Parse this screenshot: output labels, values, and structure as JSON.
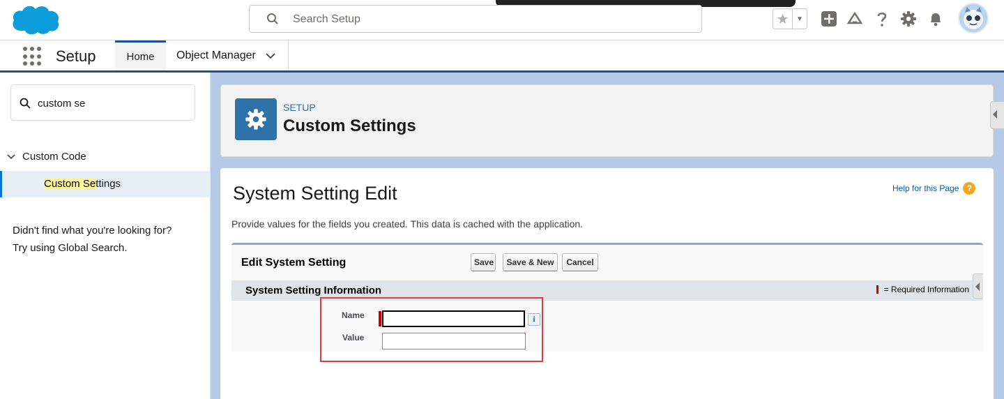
{
  "header": {
    "search_placeholder": "Search Setup",
    "icons": [
      "salesforce-logo",
      "search-icon",
      "favorites-star-icon",
      "favorites-caret-icon",
      "global-actions-plus-icon",
      "trailhead-icon",
      "help-icon",
      "gear-icon",
      "bell-icon",
      "avatar"
    ]
  },
  "nav": {
    "app_name": "Setup",
    "tabs": [
      {
        "label": "Home"
      },
      {
        "label": "Object Manager"
      }
    ]
  },
  "sidebar": {
    "quick_find_value": "custom se",
    "tree_parent": "Custom Code",
    "tree_child_highlight": "Custom Se",
    "tree_child_rest": "ttings",
    "not_found_line1": "Didn't find what you're looking for?",
    "not_found_line2": "Try using Global Search."
  },
  "page_header": {
    "kicker": "SETUP",
    "title": "Custom Settings"
  },
  "content": {
    "title": "System Setting Edit",
    "help_link": "Help for this Page",
    "help_icon": "?",
    "description": "Provide values for the fields you created. This data is cached with the application.",
    "block_title": "Edit System Setting",
    "buttons": {
      "save": "Save",
      "save_new": "Save & New",
      "cancel": "Cancel"
    },
    "section_title": "System Setting Information",
    "required_legend": "= Required Information",
    "fields": [
      {
        "label": "Name",
        "value": "",
        "required": true
      },
      {
        "label": "Value",
        "value": "",
        "required": false
      }
    ],
    "info_icon": "i"
  },
  "colors": {
    "brand_blue": "#1b5297",
    "page_bg": "#b5cae6",
    "header_icon_bg": "#2f72a8",
    "required_red": "#c00",
    "annotation_red": "#e03c3c"
  }
}
